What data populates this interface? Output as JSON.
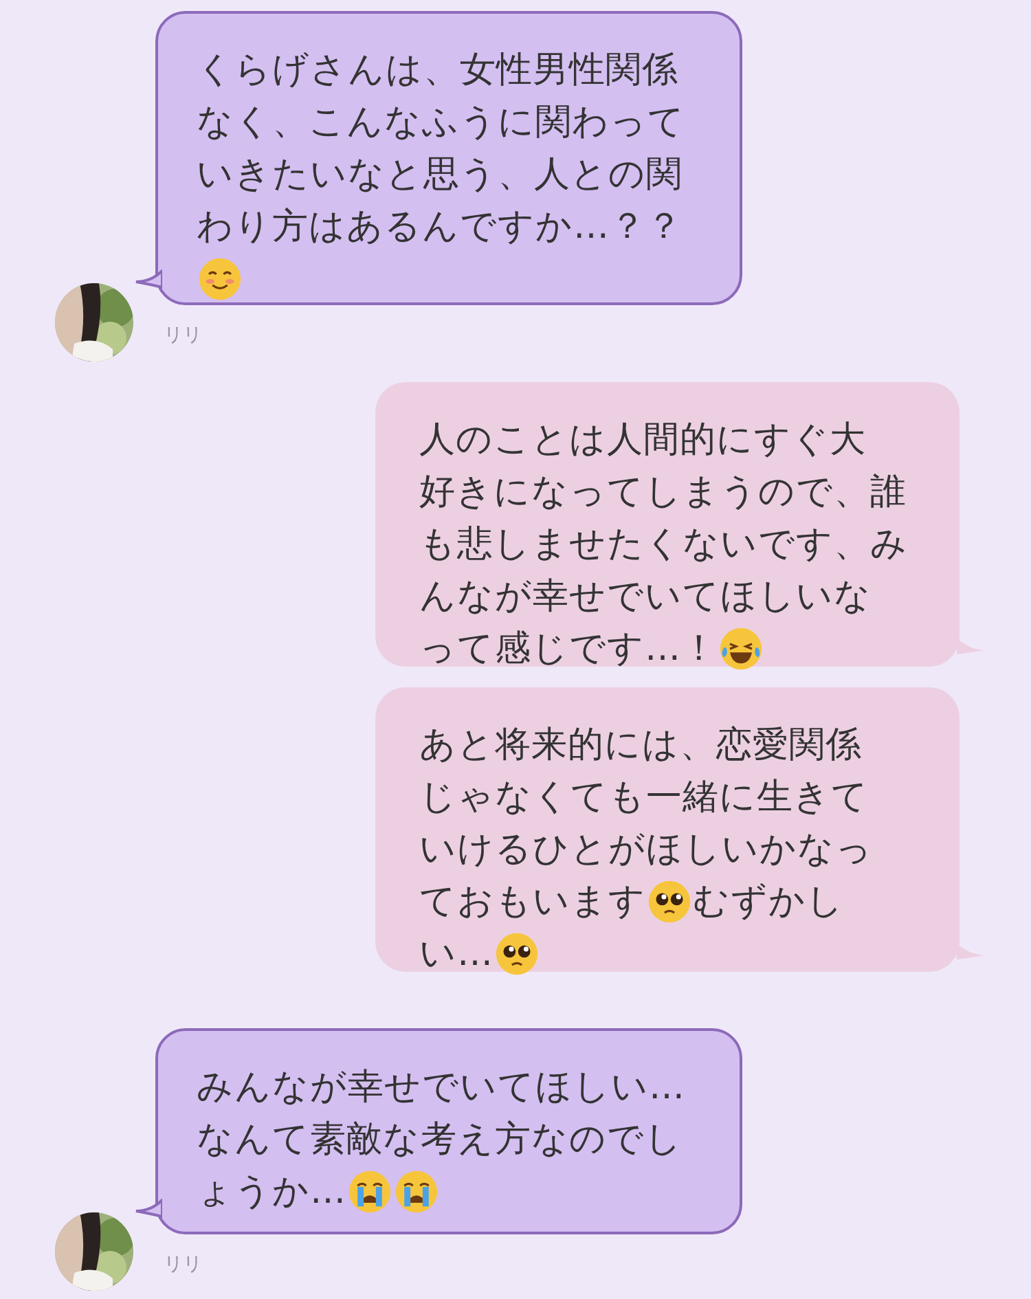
{
  "messages": [
    {
      "kind": "received",
      "sender": "リリ",
      "lines": [
        [
          {
            "kind": "text",
            "text": "くらげさんは、女性男性関係"
          }
        ],
        [
          {
            "kind": "text",
            "text": "なく、こんなふうに関わって"
          }
        ],
        [
          {
            "kind": "text",
            "text": "いきたいなと思う、人との関"
          }
        ],
        [
          {
            "kind": "text",
            "text": "わり方はあるんですか…？？"
          }
        ],
        [
          {
            "kind": "blush"
          }
        ]
      ]
    },
    {
      "kind": "sent",
      "lines": [
        [
          {
            "kind": "text",
            "text": "人のことは人間的にすぐ大"
          }
        ],
        [
          {
            "kind": "text",
            "text": "好きになってしまうので、誰"
          }
        ],
        [
          {
            "kind": "text",
            "text": "も悲しませたくないです、み"
          }
        ],
        [
          {
            "kind": "text",
            "text": "んなが幸せでいてほしいな"
          }
        ],
        [
          {
            "kind": "text",
            "text": "って感じです…！"
          },
          {
            "kind": "laugh_cry"
          }
        ]
      ]
    },
    {
      "kind": "sent",
      "lines": [
        [
          {
            "kind": "text",
            "text": "あと将来的には、恋愛関係"
          }
        ],
        [
          {
            "kind": "text",
            "text": "じゃなくても一緒に生きて"
          }
        ],
        [
          {
            "kind": "text",
            "text": "いけるひとがほしいかなっ"
          }
        ],
        [
          {
            "kind": "text",
            "text": "ておもいます"
          },
          {
            "kind": "pleading"
          },
          {
            "kind": "text",
            "text": "むずかし"
          }
        ],
        [
          {
            "kind": "text",
            "text": "い…"
          },
          {
            "kind": "pleading"
          }
        ]
      ]
    },
    {
      "kind": "received",
      "sender": "リリ",
      "lines": [
        [
          {
            "kind": "text",
            "text": "みんなが幸せでいてほしい…"
          }
        ],
        [
          {
            "kind": "text",
            "text": "なんて素敵な考え方なのでし"
          }
        ],
        [
          {
            "kind": "text",
            "text": "ょうか…"
          },
          {
            "kind": "crying"
          },
          {
            "kind": "crying"
          }
        ]
      ]
    }
  ]
}
